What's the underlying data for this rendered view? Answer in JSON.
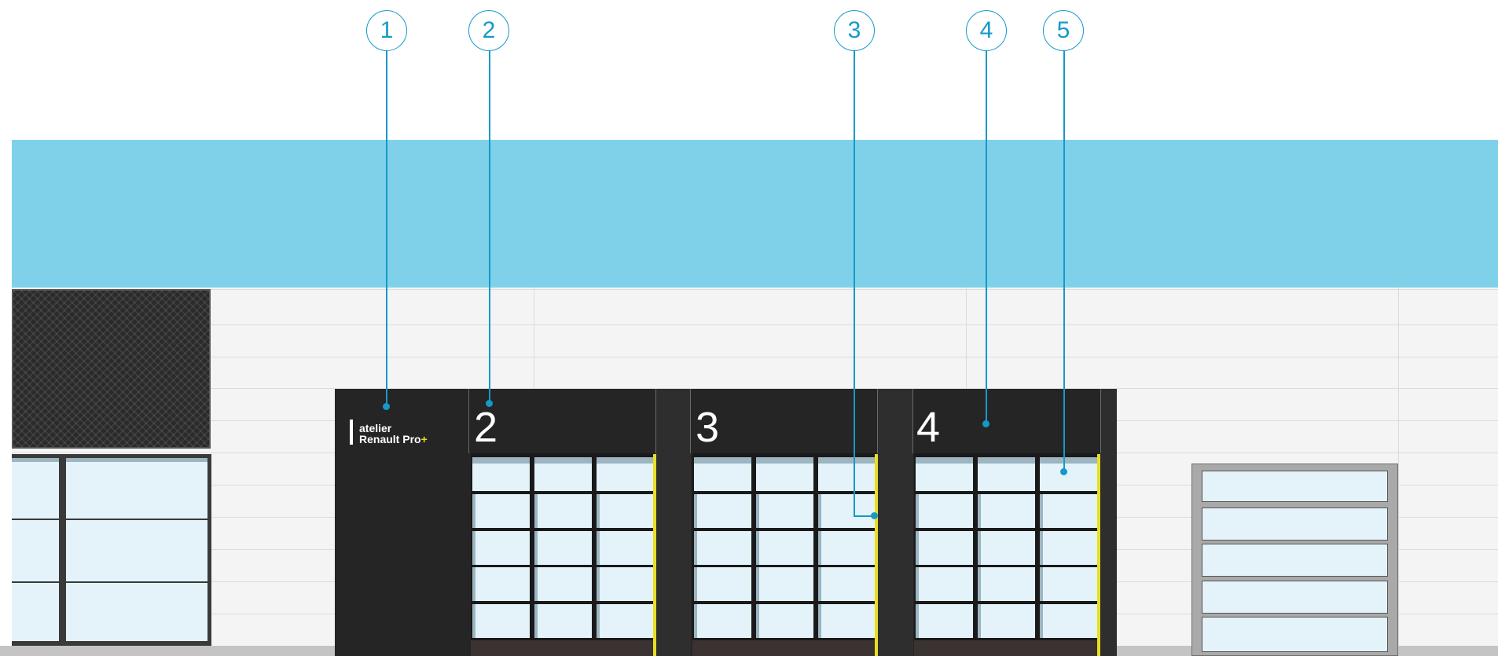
{
  "signage": {
    "logo_line1": "atelier",
    "logo_line2": "Renault Pro",
    "logo_plus": "+"
  },
  "bays": [
    {
      "number": "2"
    },
    {
      "number": "3"
    },
    {
      "number": "4"
    }
  ],
  "callouts": [
    {
      "label": "1"
    },
    {
      "label": "2"
    },
    {
      "label": "3"
    },
    {
      "label": "4"
    },
    {
      "label": "5"
    }
  ],
  "colors": {
    "canopy": "#7fd1e9",
    "facade": "#f4f4f4",
    "dark_panel": "#252525",
    "door_rail": "#e8de22",
    "glass": "#e3f3f9",
    "callout": "#1599c9",
    "logo_accent": "#e8e21a"
  }
}
